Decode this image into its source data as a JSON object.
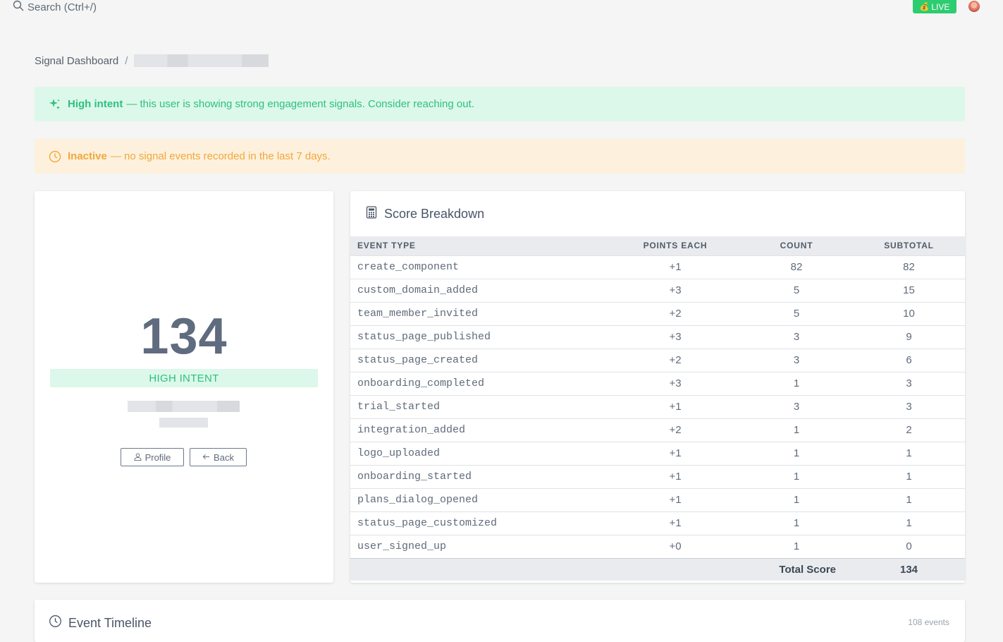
{
  "topbar": {
    "search_label": "Search (Ctrl+/)",
    "live_label": "LIVE",
    "live_icon": "money-bag-icon"
  },
  "breadcrumb": {
    "root": "Signal Dashboard",
    "separator": "/"
  },
  "alerts": {
    "intent": {
      "title": "High intent",
      "message": "— this user is showing strong engagement signals. Consider reaching out.",
      "color": "#2ec07e",
      "background": "#dcf8ea"
    },
    "inactive": {
      "title": "Inactive",
      "message": "— no signal events recorded in the last 7 days.",
      "color": "#f2a73b",
      "background": "#fdf1dd"
    }
  },
  "score_card": {
    "score": "134",
    "intent_label": "HIGH INTENT",
    "profile_button": "Profile",
    "back_button": "Back"
  },
  "breakdown": {
    "title": "Score Breakdown",
    "columns": [
      "EVENT TYPE",
      "POINTS EACH",
      "COUNT",
      "SUBTOTAL"
    ],
    "rows": [
      {
        "event": "create_component",
        "points": "+1",
        "count": "82",
        "subtotal": "82"
      },
      {
        "event": "custom_domain_added",
        "points": "+3",
        "count": "5",
        "subtotal": "15"
      },
      {
        "event": "team_member_invited",
        "points": "+2",
        "count": "5",
        "subtotal": "10"
      },
      {
        "event": "status_page_published",
        "points": "+3",
        "count": "3",
        "subtotal": "9"
      },
      {
        "event": "status_page_created",
        "points": "+2",
        "count": "3",
        "subtotal": "6"
      },
      {
        "event": "onboarding_completed",
        "points": "+3",
        "count": "1",
        "subtotal": "3"
      },
      {
        "event": "trial_started",
        "points": "+1",
        "count": "3",
        "subtotal": "3"
      },
      {
        "event": "integration_added",
        "points": "+2",
        "count": "1",
        "subtotal": "2"
      },
      {
        "event": "logo_uploaded",
        "points": "+1",
        "count": "1",
        "subtotal": "1"
      },
      {
        "event": "onboarding_started",
        "points": "+1",
        "count": "1",
        "subtotal": "1"
      },
      {
        "event": "plans_dialog_opened",
        "points": "+1",
        "count": "1",
        "subtotal": "1"
      },
      {
        "event": "status_page_customized",
        "points": "+1",
        "count": "1",
        "subtotal": "1"
      },
      {
        "event": "user_signed_up",
        "points": "+0",
        "count": "1",
        "subtotal": "0"
      }
    ],
    "total_label": "Total Score",
    "total_value": "134"
  },
  "timeline": {
    "title": "Event Timeline",
    "count_label": "108 events"
  },
  "colors": {
    "accent_green": "#2ecc71",
    "event_code": "#d6336c",
    "score_text": "#5f6b7e"
  }
}
